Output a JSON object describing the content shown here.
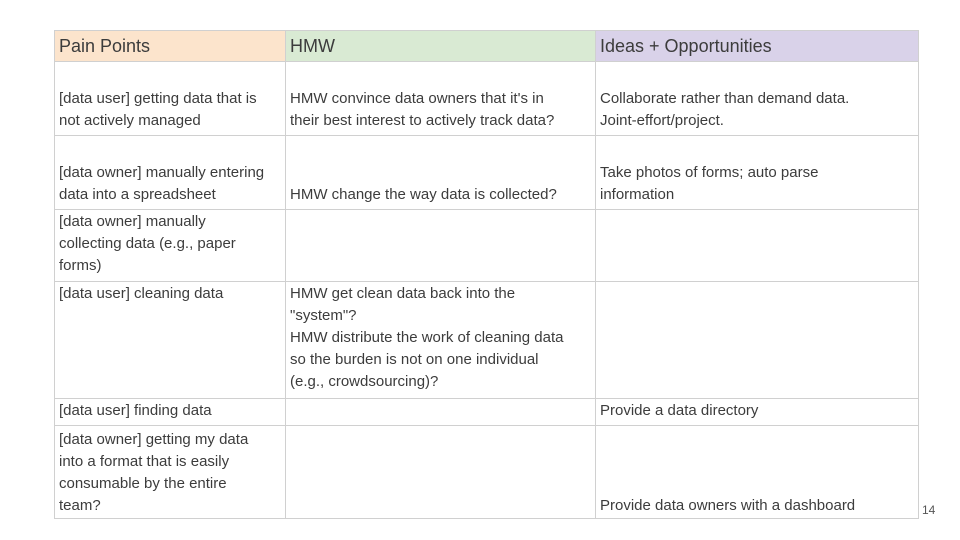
{
  "headers": [
    "Pain Points",
    "HMW",
    "Ideas + Opportunities"
  ],
  "header_colors": [
    "#fce4cc",
    "#d9ead3",
    "#d9d2e9"
  ],
  "rows": [
    [
      "[data user] getting data that is\nnot actively managed",
      "HMW convince data owners that it's in\ntheir best interest to actively track data?",
      "Collaborate rather than demand data.\nJoint-effort/project."
    ],
    [
      "[data owner] manually entering\ndata into a spreadsheet",
      "HMW change the way data is collected?",
      "Take photos of forms; auto parse\ninformation"
    ],
    [
      "[data owner] manually\ncollecting data (e.g., paper\nforms)",
      "",
      ""
    ],
    [
      "[data user] cleaning data",
      "HMW get clean data back into the\n\"system\"?\nHMW distribute the work of cleaning data\nso the burden is not on one individual\n(e.g., crowdsourcing)?",
      ""
    ],
    [
      "[data user] finding data",
      "",
      "Provide a data directory"
    ],
    [
      "[data owner] getting my data\ninto a format that is easily\nconsumable by the entire\nteam?",
      "",
      "Provide data owners with a dashboard"
    ]
  ],
  "page_number": "14"
}
